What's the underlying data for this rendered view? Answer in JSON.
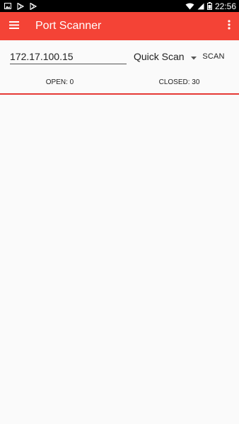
{
  "status_bar": {
    "time": "22:56",
    "icons": [
      "gallery-icon",
      "play-store-icon",
      "play-store-icon",
      "wifi-icon",
      "signal-icon",
      "battery-icon"
    ]
  },
  "app_bar": {
    "title": "Port Scanner",
    "background": "#f44336",
    "menu_icon": "hamburger-menu-icon",
    "overflow_icon": "more-vert-icon"
  },
  "controls": {
    "ip_value": "172.17.100.15",
    "scan_type": "Quick Scan",
    "scan_button": "SCAN"
  },
  "tabs": {
    "open": "OPEN: 0",
    "closed": "CLOSED: 30",
    "indicator_color": "#e53935"
  }
}
